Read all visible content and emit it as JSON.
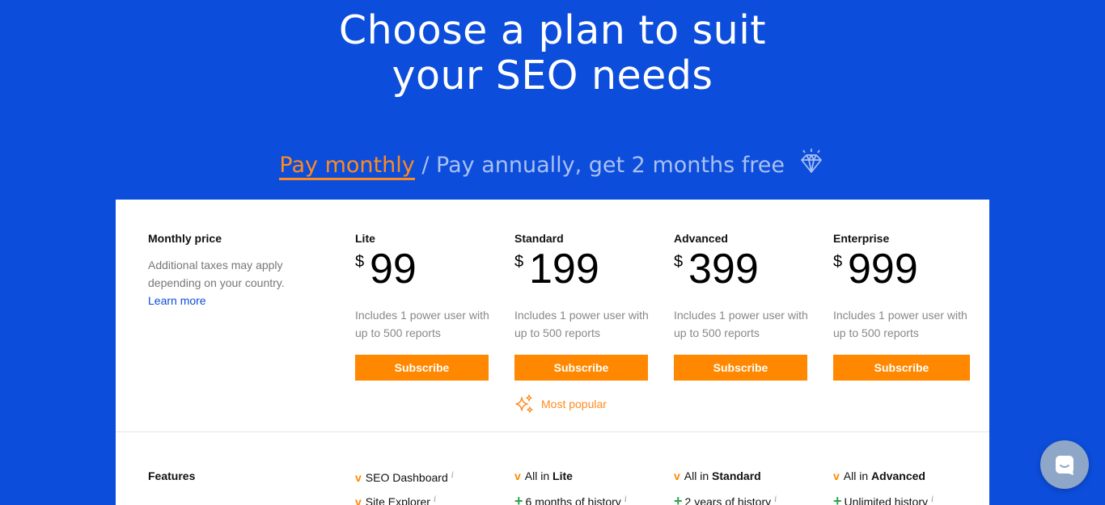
{
  "hero": {
    "line1": "Choose a plan to suit",
    "line2": "your SEO needs"
  },
  "billing": {
    "monthly": "Pay monthly",
    "separator": "/",
    "annual": "Pay annually, get 2 months free",
    "diamond_icon": "diamond-icon"
  },
  "pricing": {
    "label_title": "Monthly price",
    "label_note": "Additional taxes may apply depending on your country.",
    "learn_more": "Learn more",
    "currency": "$",
    "plans": [
      {
        "name": "Lite",
        "price": "99",
        "desc": "Includes 1 power user with up to 500 reports",
        "cta": "Subscribe"
      },
      {
        "name": "Standard",
        "price": "199",
        "desc": "Includes 1 power user with up to 500 reports",
        "cta": "Subscribe"
      },
      {
        "name": "Advanced",
        "price": "399",
        "desc": "Includes 1 power user with up to 500 reports",
        "cta": "Subscribe"
      },
      {
        "name": "Enterprise",
        "price": "999",
        "desc": "Includes 1 power user with up to 500 reports",
        "cta": "Subscribe"
      }
    ],
    "most_popular": "Most popular"
  },
  "features": {
    "label": "Features",
    "check_glyph": "v",
    "plus_glyph": "+",
    "info_glyph": "i",
    "lite": [
      "SEO Dashboard",
      "Site Explorer"
    ],
    "standard": {
      "all_in_prefix": "All in",
      "all_in_plan": "Lite",
      "extra": "6 months of history"
    },
    "advanced": {
      "all_in_prefix": "All in",
      "all_in_plan": "Standard",
      "extra": "2 years of history"
    },
    "enterprise": {
      "all_in_prefix": "All in",
      "all_in_plan": "Advanced",
      "extra": "Unlimited history"
    }
  },
  "colors": {
    "background": "#0c4ddb",
    "accent": "#ff8800",
    "plus": "#2aa44f"
  },
  "chat_icon": "chat-icon"
}
